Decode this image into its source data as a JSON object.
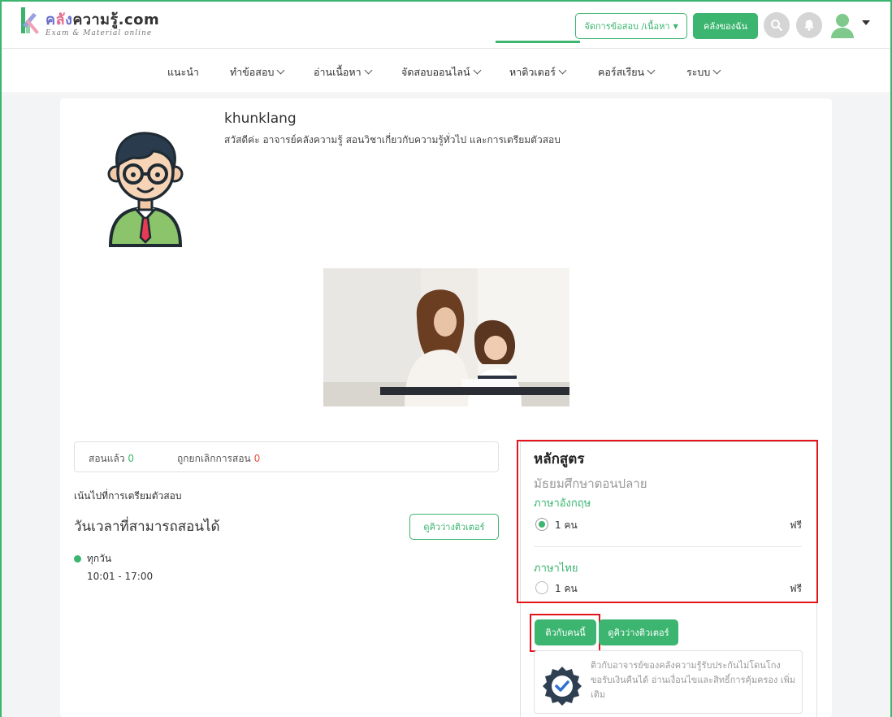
{
  "header": {
    "logo_main": "คลังความรู้.com",
    "logo_main_parts": [
      "ค",
      "ลั",
      "ง",
      "ความรู้.com"
    ],
    "logo_sub": "Exam & Material online",
    "manage_button": "จัดการข้อสอบ /เนื้อหา",
    "library_button": "คลังของฉัน",
    "icons": [
      "search-icon",
      "bell-icon",
      "user-icon"
    ]
  },
  "nav": {
    "items": [
      {
        "label": "แนะนำ",
        "has_menu": false
      },
      {
        "label": "ทำข้อสอบ",
        "has_menu": true
      },
      {
        "label": "อ่านเนื้อหา",
        "has_menu": true
      },
      {
        "label": "จัดสอบออนไลน์",
        "has_menu": true
      },
      {
        "label": "หาติวเตอร์",
        "has_menu": true,
        "active": true
      },
      {
        "label": "คอร์สเรียน",
        "has_menu": true
      },
      {
        "label": "ระบบ",
        "has_menu": true
      }
    ]
  },
  "profile": {
    "username": "khunklang",
    "bio": "สวัสดีค่ะ อาจารย์คลังความรู้ สอนวิชาเกี่ยวกับความรู้ทั่วไป และการเตรียมตัวสอบ"
  },
  "stats": {
    "taught_label": "สอนแล้ว",
    "taught_value": "0",
    "cancelled_label": "ถูกยกเลิกการสอน",
    "cancelled_value": "0"
  },
  "focus_text": "เน้นไปที่การเตรียมตัวสอบ",
  "availability": {
    "title": "วันเวลาที่สามารถสอนได้",
    "button": "ดูคิวว่างติวเตอร์",
    "day": "ทุกวัน",
    "time": "10:01 - 17:00"
  },
  "course": {
    "title": "หลักสูตร",
    "level": "มัธยมศึกษาตอนปลาย",
    "options": [
      {
        "subject": "ภาษาอังกฤษ",
        "label": "1 คน",
        "price": "ฟรี",
        "checked": true
      },
      {
        "subject": "ภาษาไทย",
        "label": "1 คน",
        "price": "ฟรี",
        "checked": false
      }
    ],
    "tutor_button": "ติวกับคนนี้",
    "queue_button": "ดูคิวว่างติวเตอร์",
    "guarantee": "ติวกับอาจารย์ของคลังความรู้รับประกันไม่โดนโกง ขอรับเงินคืนได้ อ่านเงื่อนไขและสิทธิ์การคุ้มครอง เพิ่มเติม"
  },
  "colors": {
    "accent": "#3bb56f",
    "highlight": "#e3141b",
    "danger_text": "#e0533c"
  }
}
